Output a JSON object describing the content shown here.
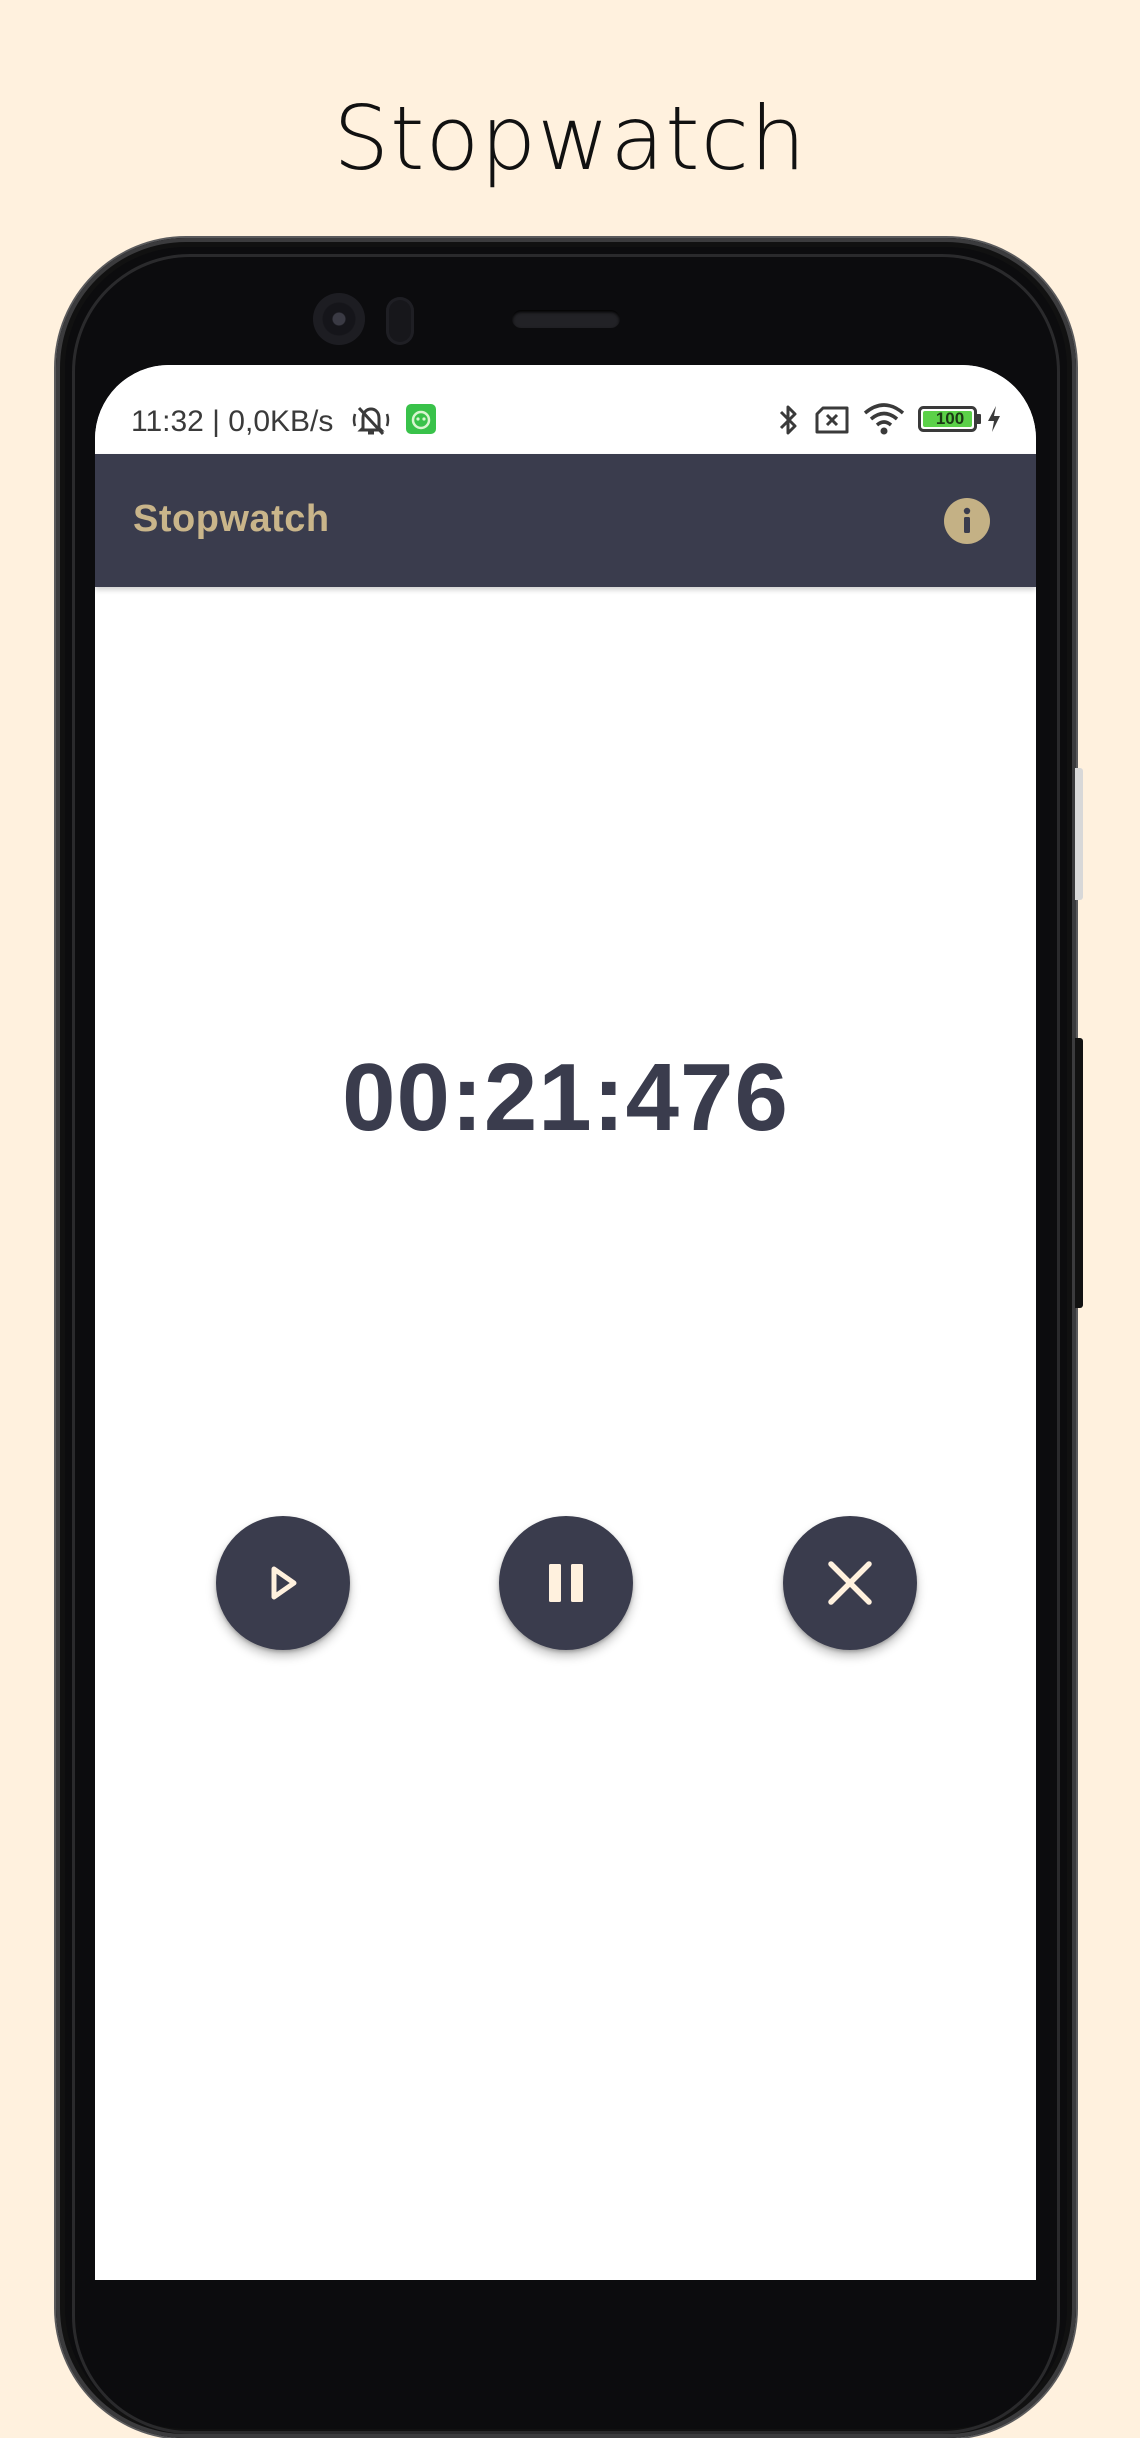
{
  "promo": {
    "title": "Stopwatch"
  },
  "status_bar": {
    "time_text": "11:32 | 0,0KB/s",
    "battery_level": "100",
    "icons": [
      "mute-vibrate-icon",
      "app-notification-icon",
      "bluetooth-icon",
      "no-sim-icon",
      "wifi-icon",
      "battery-icon",
      "charging-icon"
    ]
  },
  "app_bar": {
    "title": "Stopwatch",
    "info_icon": "info-icon"
  },
  "stopwatch": {
    "display": "00:21:476"
  },
  "controls": [
    {
      "name": "start",
      "icon": "play-icon"
    },
    {
      "name": "pause",
      "icon": "pause-icon"
    },
    {
      "name": "reset",
      "icon": "close-icon"
    }
  ],
  "colors": {
    "background": "#fff1de",
    "primary": "#3a3c4d",
    "accent": "#c9b58a",
    "icon_fill": "#fff1de"
  }
}
